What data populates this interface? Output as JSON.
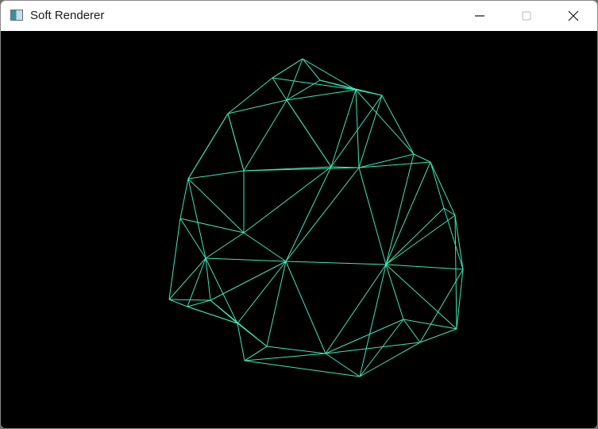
{
  "window": {
    "title": "Soft Renderer",
    "icon": "app-window-icon",
    "controls": [
      {
        "name": "minimize-button",
        "icon": "minimize-icon"
      },
      {
        "name": "maximize-button",
        "icon": "maximize-icon"
      },
      {
        "name": "close-button",
        "icon": "close-icon"
      }
    ]
  },
  "viewport": {
    "background": "#000000",
    "wire_color": "#3ee6b4",
    "content": "wireframe-polyhedron"
  }
}
